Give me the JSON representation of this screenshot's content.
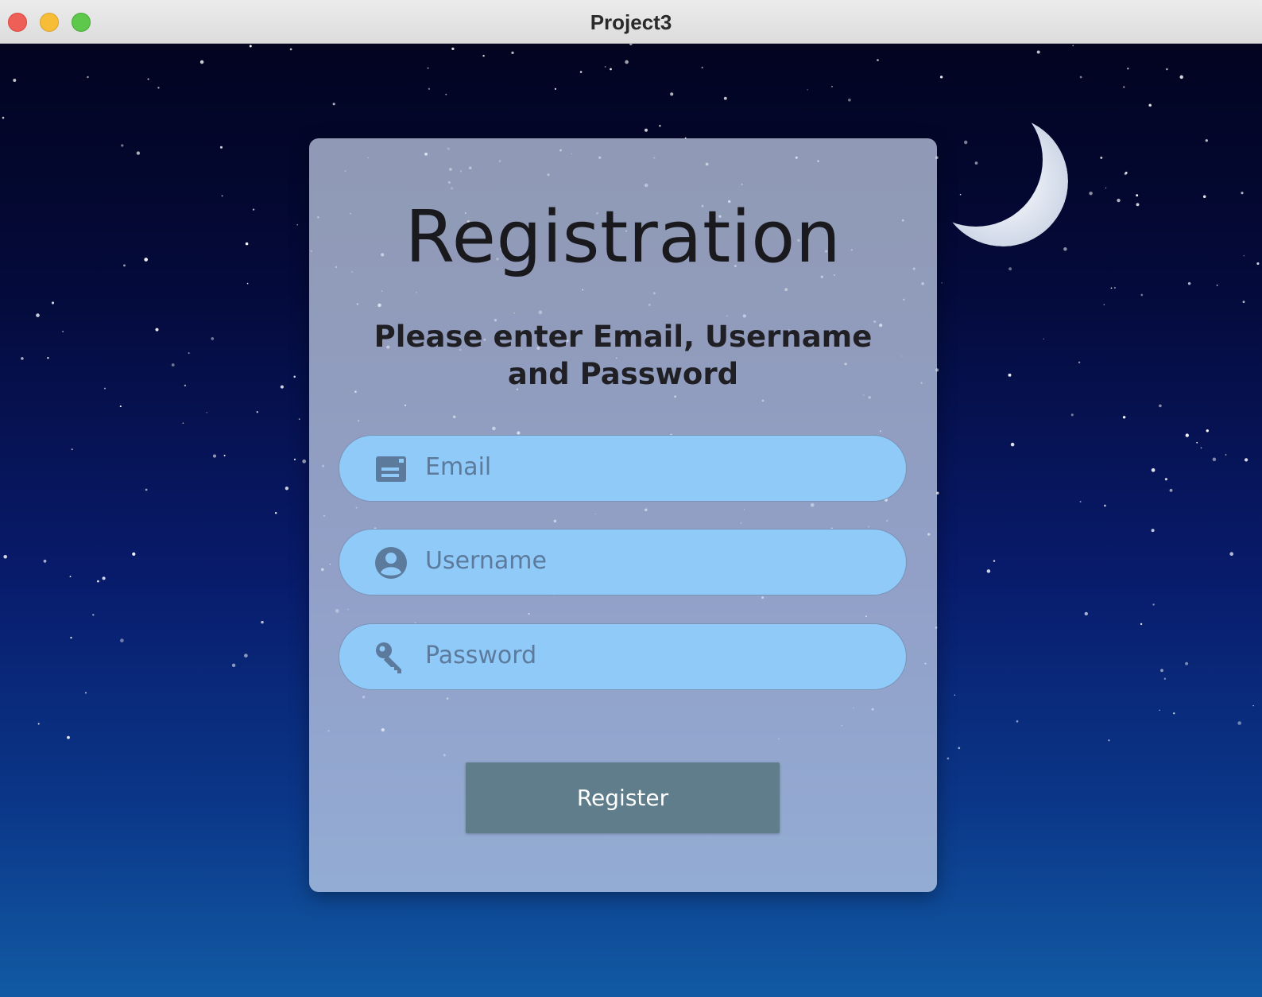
{
  "window": {
    "title": "Project3"
  },
  "form": {
    "heading": "Registration",
    "subheading": "Please enter Email, Username and Password",
    "fields": [
      {
        "icon": "email-card-icon",
        "placeholder": "Email"
      },
      {
        "icon": "account-circle-icon",
        "placeholder": "Username"
      },
      {
        "icon": "key-icon",
        "placeholder": "Password"
      }
    ],
    "register_label": "Register"
  },
  "colors": {
    "field_background": "#90caf9",
    "button_background": "#607d8b",
    "sky_top": "#020420",
    "sky_bottom": "#115aa3"
  }
}
